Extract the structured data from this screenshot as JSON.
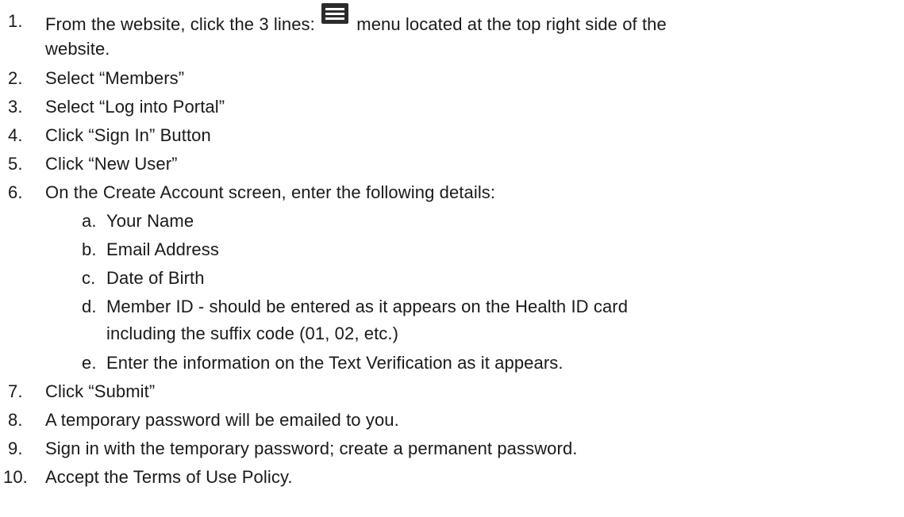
{
  "steps": [
    {
      "num": "1.",
      "text_before_icon": "From the website, click the 3 lines:",
      "icon": "hamburger-menu-icon",
      "text_after_icon": "menu located at the top right side of the",
      "continuation": "website."
    },
    {
      "num": "2.",
      "text": "Select “Members”"
    },
    {
      "num": "3.",
      "text": "Select “Log into Portal”"
    },
    {
      "num": "4.",
      "text": "Click “Sign In” Button"
    },
    {
      "num": "5.",
      "text": "Click “New User”"
    },
    {
      "num": "6.",
      "text": "On the Create Account screen, enter the following details:",
      "substeps": [
        {
          "num": "a.",
          "text": "Your Name"
        },
        {
          "num": "b.",
          "text": "Email Address"
        },
        {
          "num": "c.",
          "text": "Date of Birth"
        },
        {
          "num": "d.",
          "text": "Member ID - should be entered as it appears on the Health ID card",
          "continuation": "including the suffix code (01, 02, etc.)"
        },
        {
          "num": "e.",
          "text": "Enter the information on the Text Verification as it appears."
        }
      ]
    },
    {
      "num": "7.",
      "text": "Click “Submit”"
    },
    {
      "num": "8.",
      "text": "A temporary password will be emailed to you."
    },
    {
      "num": "9.",
      "text": "Sign in with the temporary password; create a permanent password."
    },
    {
      "num": "10.",
      "text": "Accept the Terms of Use Policy."
    }
  ],
  "colors": {
    "text": "#1a1a1a",
    "icon_bg": "#2b2b2b"
  }
}
